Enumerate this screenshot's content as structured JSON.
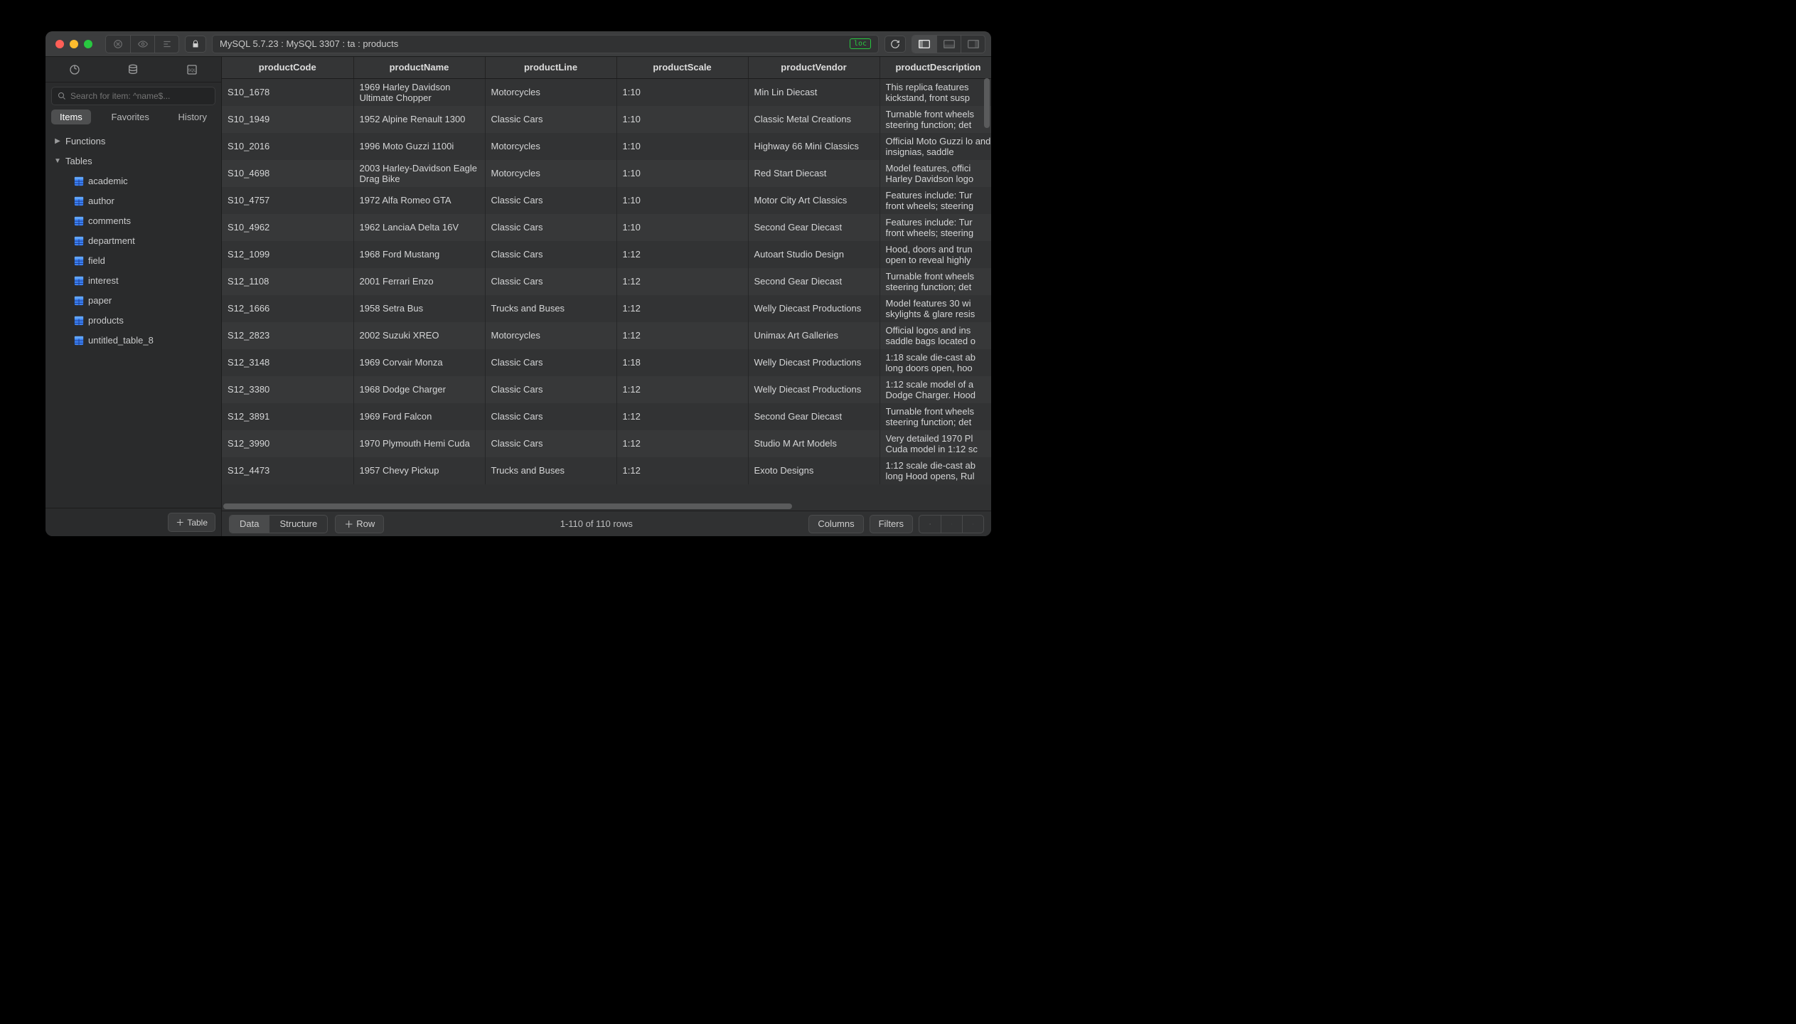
{
  "titlebar": {
    "breadcrumb": "MySQL 5.7.23 : MySQL 3307 : ta : products",
    "badge": "loc"
  },
  "sidebar": {
    "search_placeholder": "Search for item: ^name$...",
    "scopes": [
      "Items",
      "Favorites",
      "History"
    ],
    "groups": [
      {
        "label": "Functions"
      },
      {
        "label": "Tables"
      }
    ],
    "tables": [
      "academic",
      "author",
      "comments",
      "department",
      "field",
      "interest",
      "paper",
      "products",
      "untitled_table_8"
    ],
    "add_table_label": "Table"
  },
  "columns": [
    "productCode",
    "productName",
    "productLine",
    "productScale",
    "productVendor",
    "productDescription"
  ],
  "rows": [
    {
      "productCode": "S10_1678",
      "productName": "1969 Harley Davidson Ultimate Chopper",
      "productLine": "Motorcycles",
      "productScale": "1:10",
      "productVendor": "Min Lin Diecast",
      "productDescription": "This replica features kickstand, front susp"
    },
    {
      "productCode": "S10_1949",
      "productName": "1952 Alpine Renault 1300",
      "productLine": "Classic Cars",
      "productScale": "1:10",
      "productVendor": "Classic Metal Creations",
      "productDescription": "Turnable front wheels steering function; det"
    },
    {
      "productCode": "S10_2016",
      "productName": "1996 Moto Guzzi 1100i",
      "productLine": "Motorcycles",
      "productScale": "1:10",
      "productVendor": "Highway 66 Mini Classics",
      "productDescription": "Official Moto Guzzi lo and insignias, saddle"
    },
    {
      "productCode": "S10_4698",
      "productName": "2003 Harley-Davidson Eagle Drag Bike",
      "productLine": "Motorcycles",
      "productScale": "1:10",
      "productVendor": "Red Start Diecast",
      "productDescription": "Model features, offici Harley Davidson logo"
    },
    {
      "productCode": "S10_4757",
      "productName": "1972 Alfa Romeo GTA",
      "productLine": "Classic Cars",
      "productScale": "1:10",
      "productVendor": "Motor City Art Classics",
      "productDescription": "Features include: Tur front wheels; steering"
    },
    {
      "productCode": "S10_4962",
      "productName": "1962 LanciaA Delta 16V",
      "productLine": "Classic Cars",
      "productScale": "1:10",
      "productVendor": "Second Gear Diecast",
      "productDescription": "Features include: Tur front wheels; steering"
    },
    {
      "productCode": "S12_1099",
      "productName": "1968 Ford Mustang",
      "productLine": "Classic Cars",
      "productScale": "1:12",
      "productVendor": "Autoart Studio Design",
      "productDescription": "Hood, doors and trun open to reveal highly"
    },
    {
      "productCode": "S12_1108",
      "productName": "2001 Ferrari Enzo",
      "productLine": "Classic Cars",
      "productScale": "1:12",
      "productVendor": "Second Gear Diecast",
      "productDescription": "Turnable front wheels steering function; det"
    },
    {
      "productCode": "S12_1666",
      "productName": "1958 Setra Bus",
      "productLine": "Trucks and Buses",
      "productScale": "1:12",
      "productVendor": "Welly Diecast Productions",
      "productDescription": "Model features 30 wi skylights & glare resis"
    },
    {
      "productCode": "S12_2823",
      "productName": "2002 Suzuki XREO",
      "productLine": "Motorcycles",
      "productScale": "1:12",
      "productVendor": "Unimax Art Galleries",
      "productDescription": "Official logos and ins saddle bags located o"
    },
    {
      "productCode": "S12_3148",
      "productName": "1969 Corvair Monza",
      "productLine": "Classic Cars",
      "productScale": "1:18",
      "productVendor": "Welly Diecast Productions",
      "productDescription": "1:18 scale die-cast ab long doors open, hoo"
    },
    {
      "productCode": "S12_3380",
      "productName": "1968 Dodge Charger",
      "productLine": "Classic Cars",
      "productScale": "1:12",
      "productVendor": "Welly Diecast Productions",
      "productDescription": "1:12 scale model of a Dodge Charger. Hood"
    },
    {
      "productCode": "S12_3891",
      "productName": "1969 Ford Falcon",
      "productLine": "Classic Cars",
      "productScale": "1:12",
      "productVendor": "Second Gear Diecast",
      "productDescription": "Turnable front wheels steering function; det"
    },
    {
      "productCode": "S12_3990",
      "productName": "1970 Plymouth Hemi Cuda",
      "productLine": "Classic Cars",
      "productScale": "1:12",
      "productVendor": "Studio M Art Models",
      "productDescription": "Very detailed 1970 Pl Cuda model in 1:12 sc"
    },
    {
      "productCode": "S12_4473",
      "productName": "1957 Chevy Pickup",
      "productLine": "Trucks and Buses",
      "productScale": "1:12",
      "productVendor": "Exoto Designs",
      "productDescription": "1:12 scale die-cast ab long Hood opens, Rul"
    }
  ],
  "statusbar": {
    "mode": [
      "Data",
      "Structure"
    ],
    "add_row_label": "Row",
    "row_count": "1-110 of 110 rows",
    "columns_label": "Columns",
    "filters_label": "Filters"
  }
}
